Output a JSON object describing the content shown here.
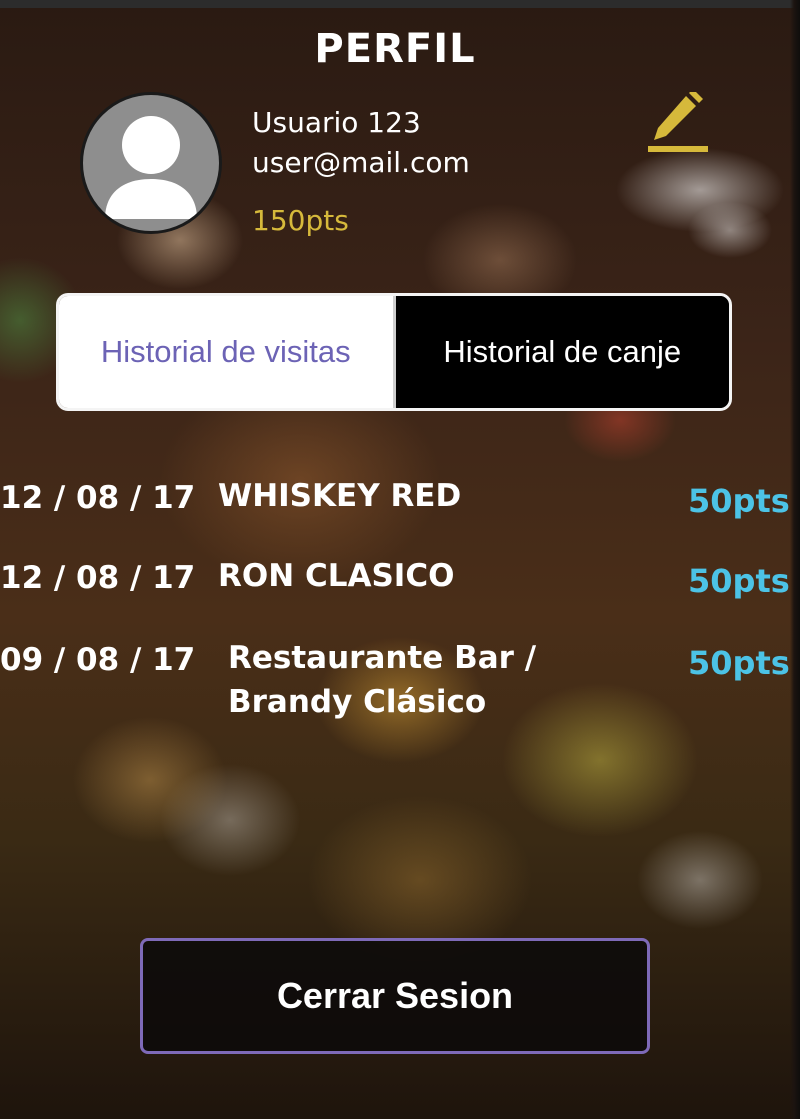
{
  "header": {
    "title": "PERFIL"
  },
  "profile": {
    "avatar_icon": "user-avatar-icon",
    "name": "Usuario 123",
    "email": "user@mail.com",
    "points": "150pts",
    "edit_icon": "pencil-edit-icon"
  },
  "tabs": [
    {
      "label": "Historial de visitas",
      "selected": false
    },
    {
      "label": "Historial de canje",
      "selected": true
    }
  ],
  "history": [
    {
      "date": "12 / 08 / 17",
      "item": "WHISKEY RED",
      "item_line2": "",
      "points": "50pts"
    },
    {
      "date": "12 / 08 / 17",
      "item": "RON CLASICO",
      "item_line2": "",
      "points": "50pts"
    },
    {
      "date": "09 / 08 / 17",
      "item": "Restaurante Bar /",
      "item_line2": "Brandy Clásico",
      "points": "50pts"
    }
  ],
  "logout": {
    "label": "Cerrar Sesion"
  },
  "colors": {
    "points_gold": "#d6b93b",
    "points_blue": "#4cc3e6",
    "tab_accent": "#6c63b5",
    "button_border": "#7e6ab8"
  }
}
